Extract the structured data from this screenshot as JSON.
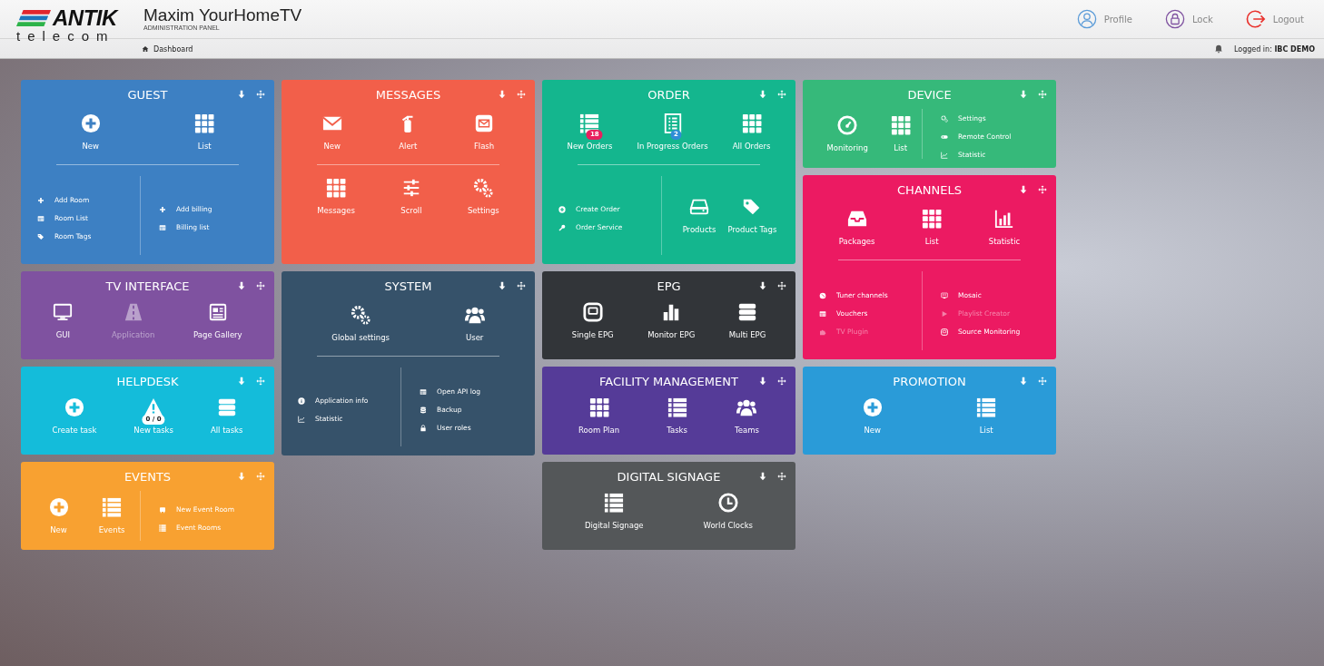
{
  "header": {
    "logo_word": "ANTIK",
    "logo_sub": "telecom",
    "title": "Maxim YourHomeTV",
    "subtitle": "ADMINISTRATION PANEL",
    "breadcrumb": "Dashboard",
    "actions": [
      {
        "label": "Profile"
      },
      {
        "label": "Lock"
      },
      {
        "label": "Logout"
      }
    ],
    "logged_in": "Logged in: **IBC DEMO**"
  },
  "columns": [
    [
      {
        "title": "GUEST",
        "color": "#3d80c3",
        "sections": [
          {
            "kind": "buttons",
            "items": [
              {
                "label": "New",
                "disabled": false
              },
              {
                "label": "List",
                "disabled": false
              }
            ]
          },
          {
            "kind": "rule"
          },
          {
            "kind": "split",
            "columns": [
              {
                "kind": "links",
                "items": [
                  {
                    "label": "Add Room",
                    "disabled": false
                  },
                  {
                    "label": "Room List",
                    "disabled": false
                  },
                  {
                    "label": "Room Tags",
                    "disabled": false
                  }
                ]
              },
              {
                "kind": "links",
                "items": [
                  {
                    "label": "Add billing",
                    "disabled": false
                  },
                  {
                    "label": "Billing list",
                    "disabled": false
                  }
                ]
              }
            ]
          }
        ]
      },
      {
        "title": "TV INTERFACE",
        "color": "#7f52a0",
        "sections": [
          {
            "kind": "buttons",
            "items": [
              {
                "label": "GUI",
                "disabled": false
              },
              {
                "label": "Application",
                "disabled": true
              },
              {
                "label": "Page Gallery",
                "disabled": false
              }
            ]
          }
        ]
      },
      {
        "title": "HELPDESK",
        "color": "#14bcda",
        "sections": [
          {
            "kind": "buttons",
            "items": [
              {
                "label": "Create task",
                "disabled": false
              },
              {
                "label": "New tasks",
                "disabled": false,
                "badge": {
                  "text": "0 / 0",
                  "color": "#ffffff"
                }
              },
              {
                "label": "All tasks",
                "disabled": false
              }
            ]
          }
        ]
      },
      {
        "title": "EVENTS",
        "color": "#f8a131",
        "sections": [
          {
            "kind": "split",
            "columns": [
              {
                "kind": "buttons",
                "items": [
                  {
                    "label": "New",
                    "disabled": false
                  },
                  {
                    "label": "Events",
                    "disabled": false
                  }
                ]
              },
              {
                "kind": "links",
                "items": [
                  {
                    "label": "New Event Room",
                    "disabled": false
                  },
                  {
                    "label": "Event Rooms",
                    "disabled": false
                  }
                ]
              }
            ]
          }
        ]
      }
    ],
    [
      {
        "title": "MESSAGES",
        "color": "#f25f4a",
        "sections": [
          {
            "kind": "buttons",
            "items": [
              {
                "label": "New",
                "disabled": false
              },
              {
                "label": "Alert",
                "disabled": false
              },
              {
                "label": "Flash",
                "disabled": false
              }
            ]
          },
          {
            "kind": "rule"
          },
          {
            "kind": "buttons",
            "items": [
              {
                "label": "Messages",
                "disabled": false
              },
              {
                "label": "Scroll",
                "disabled": false
              },
              {
                "label": "Settings",
                "disabled": false
              }
            ]
          }
        ]
      },
      {
        "title": "SYSTEM",
        "color": "#36526a",
        "sections": [
          {
            "kind": "buttons",
            "items": [
              {
                "label": "Global settings",
                "disabled": false
              },
              {
                "label": "User",
                "disabled": false
              }
            ]
          },
          {
            "kind": "rule"
          },
          {
            "kind": "split",
            "columns": [
              {
                "kind": "links",
                "items": [
                  {
                    "label": "Application info",
                    "disabled": false
                  },
                  {
                    "label": "Statistic",
                    "disabled": false
                  }
                ]
              },
              {
                "kind": "links",
                "items": [
                  {
                    "label": "Open API log",
                    "disabled": false
                  },
                  {
                    "label": "Backup",
                    "disabled": false
                  },
                  {
                    "label": "User roles",
                    "disabled": false
                  }
                ]
              }
            ]
          }
        ]
      }
    ],
    [
      {
        "title": "ORDER",
        "color": "#14b68e",
        "sections": [
          {
            "kind": "buttons",
            "items": [
              {
                "label": "New Orders",
                "disabled": false,
                "badge": {
                  "text": "18",
                  "color": "#e8205e"
                }
              },
              {
                "label": "In Progress Orders",
                "disabled": false,
                "badge": {
                  "text": "2",
                  "color": "#2f8ed6"
                }
              },
              {
                "label": "All Orders",
                "disabled": false
              }
            ]
          },
          {
            "kind": "rule"
          },
          {
            "kind": "split",
            "columns": [
              {
                "kind": "links",
                "items": [
                  {
                    "label": "Create Order",
                    "disabled": false
                  },
                  {
                    "label": "Order Service",
                    "disabled": false
                  }
                ]
              },
              {
                "kind": "buttons",
                "items": [
                  {
                    "label": "Products",
                    "disabled": false
                  },
                  {
                    "label": "Product Tags",
                    "disabled": false
                  }
                ]
              }
            ]
          }
        ]
      },
      {
        "title": "EPG",
        "color": "#323539",
        "sections": [
          {
            "kind": "buttons",
            "items": [
              {
                "label": "Single EPG",
                "disabled": false
              },
              {
                "label": "Monitor EPG",
                "disabled": false
              },
              {
                "label": "Multi EPG",
                "disabled": false
              }
            ]
          }
        ]
      },
      {
        "title": "FACILITY MANAGEMENT",
        "color": "#553b98",
        "sections": [
          {
            "kind": "buttons",
            "items": [
              {
                "label": "Room Plan",
                "disabled": false
              },
              {
                "label": "Tasks",
                "disabled": false
              },
              {
                "label": "Teams",
                "disabled": false
              }
            ]
          }
        ]
      },
      {
        "title": "DIGITAL SIGNAGE",
        "color": "#545759",
        "sections": [
          {
            "kind": "buttons",
            "items": [
              {
                "label": "Digital Signage",
                "disabled": false
              },
              {
                "label": "World Clocks",
                "disabled": false
              }
            ]
          }
        ]
      }
    ],
    [
      {
        "title": "DEVICE",
        "color": "#36b97a",
        "sections": [
          {
            "kind": "split",
            "columns": [
              {
                "kind": "buttons",
                "items": [
                  {
                    "label": "Monitoring",
                    "disabled": false
                  },
                  {
                    "label": "List",
                    "disabled": false
                  }
                ]
              },
              {
                "kind": "links",
                "items": [
                  {
                    "label": "Settings",
                    "disabled": false
                  },
                  {
                    "label": "Remote Control",
                    "disabled": false
                  },
                  {
                    "label": "Statistic",
                    "disabled": false
                  }
                ]
              }
            ]
          }
        ]
      },
      {
        "title": "CHANNELS",
        "color": "#ec1a62",
        "sections": [
          {
            "kind": "buttons",
            "items": [
              {
                "label": "Packages",
                "disabled": false
              },
              {
                "label": "List",
                "disabled": false
              },
              {
                "label": "Statistic",
                "disabled": false
              }
            ]
          },
          {
            "kind": "rule"
          },
          {
            "kind": "split",
            "columns": [
              {
                "kind": "links",
                "items": [
                  {
                    "label": "Tuner channels",
                    "disabled": false
                  },
                  {
                    "label": "Vouchers",
                    "disabled": false
                  },
                  {
                    "label": "TV Plugin",
                    "disabled": true
                  }
                ]
              },
              {
                "kind": "links",
                "items": [
                  {
                    "label": "Mosaic",
                    "disabled": false
                  },
                  {
                    "label": "Playlist Creator",
                    "disabled": true
                  },
                  {
                    "label": "Source Monitoring",
                    "disabled": false
                  }
                ]
              }
            ]
          }
        ]
      },
      {
        "title": "PROMOTION",
        "color": "#2a9bd8",
        "sections": [
          {
            "kind": "buttons",
            "items": [
              {
                "label": "New",
                "disabled": false
              },
              {
                "label": "List",
                "disabled": false
              }
            ]
          }
        ]
      }
    ]
  ]
}
